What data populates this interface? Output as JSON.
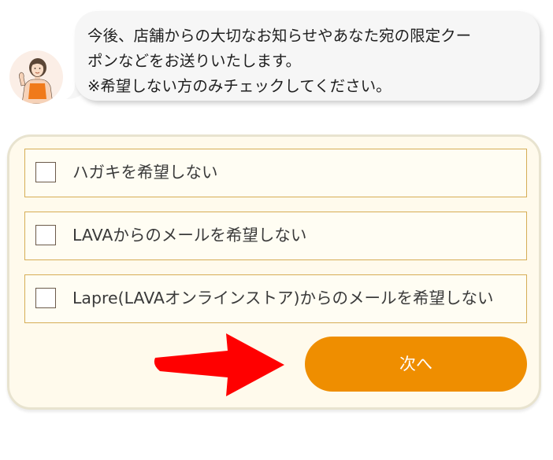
{
  "chat": {
    "lines": [
      "今後、店舗からの大切なお知らせやあなた宛の限定クー",
      "ポンなどをお送りいたします。",
      "※希望しない方のみチェックしてください。"
    ]
  },
  "options": [
    {
      "label": "ハガキを希望しない",
      "checked": false
    },
    {
      "label": "LAVAからのメールを希望しない",
      "checked": false
    },
    {
      "label": "Lapre(LAVAオンラインストア)からのメールを希望しない",
      "checked": false
    }
  ],
  "next_button": {
    "label": "次へ"
  },
  "colors": {
    "accent": "#ef8e00",
    "panel_bg": "#fffaec",
    "option_border": "#d6ad55",
    "arrow": "#ff0000",
    "bubble_bg": "#f6f6f6"
  },
  "icons": {
    "avatar": "instructor-avatar-icon",
    "arrow": "red-arrow-icon"
  }
}
